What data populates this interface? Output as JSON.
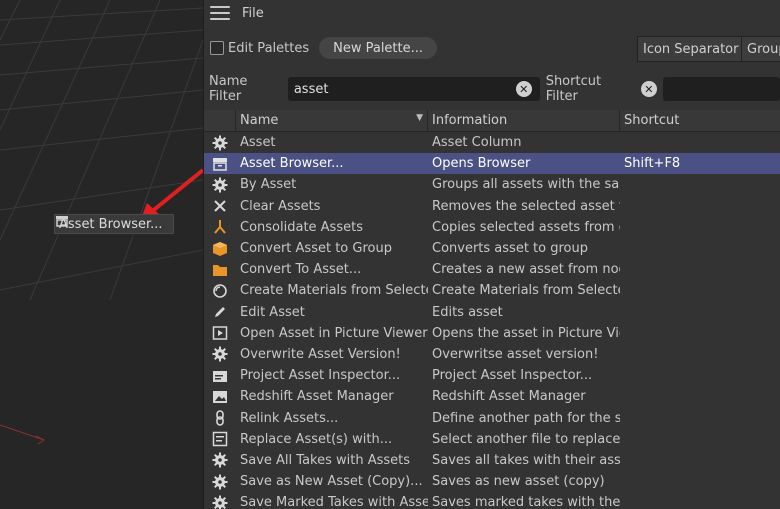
{
  "viewport": {
    "dragged_label": "Asset Browser...",
    "dragged_icon": "asset-browser-icon"
  },
  "menubar": {
    "menu_icon": "hamburger-icon",
    "file_label": "File"
  },
  "toolbar": {
    "edit_palettes_label": "Edit Palettes",
    "new_palette_label": "New Palette...",
    "icon_separator_label": "Icon Separator",
    "group_label": "Group"
  },
  "filters": {
    "name_filter_label": "Name Filter",
    "name_filter_value": "asset",
    "shortcut_filter_label": "Shortcut Filter",
    "shortcut_filter_value": ""
  },
  "table": {
    "columns": [
      "Name",
      "Information",
      "Shortcut"
    ],
    "rows": [
      {
        "icon": "gear-icon",
        "name": "Asset",
        "info": "Asset Column",
        "shortcut": ""
      },
      {
        "icon": "asset-browser-icon",
        "name": "Asset Browser...",
        "info": "Opens Browser",
        "shortcut": "Shift+F8",
        "selected": true
      },
      {
        "icon": "gear-icon",
        "name": "By Asset",
        "info": "Groups all assets with the same",
        "shortcut": ""
      },
      {
        "icon": "close-icon",
        "name": "Clear Assets",
        "info": "Removes the selected asset fro",
        "shortcut": ""
      },
      {
        "icon": "merge-icon",
        "name": "Consolidate Assets",
        "info": "Copies selected assets from dif",
        "shortcut": ""
      },
      {
        "icon": "box-icon",
        "name": "Convert Asset to Group",
        "info": "Converts asset to group",
        "shortcut": ""
      },
      {
        "icon": "folder-icon",
        "name": "Convert To Asset...",
        "info": "Creates a new asset from node",
        "shortcut": ""
      },
      {
        "icon": "material-icon",
        "name": "Create Materials from Selected",
        "info": "Create Materials from Selected",
        "shortcut": ""
      },
      {
        "icon": "pencil-icon",
        "name": "Edit Asset",
        "info": "Edits asset",
        "shortcut": ""
      },
      {
        "icon": "picture-viewer-icon",
        "name": "Open Asset in Picture Viewer",
        "info": "Opens the asset in Picture View",
        "shortcut": ""
      },
      {
        "icon": "gear-icon",
        "name": "Overwrite Asset Version!",
        "info": "Overwritse asset version!",
        "shortcut": ""
      },
      {
        "icon": "inspector-icon",
        "name": "Project Asset Inspector...",
        "info": "Project Asset Inspector...",
        "shortcut": ""
      },
      {
        "icon": "image-icon",
        "name": "Redshift Asset Manager",
        "info": "Redshift Asset Manager",
        "shortcut": ""
      },
      {
        "icon": "link-icon",
        "name": "Relink Assets...",
        "info": "Define another path for the sel",
        "shortcut": ""
      },
      {
        "icon": "replace-icon",
        "name": "Replace Asset(s) with...",
        "info": "Select another file to replace th",
        "shortcut": ""
      },
      {
        "icon": "gear-icon",
        "name": "Save All Takes with Assets",
        "info": "Saves all takes with their assets",
        "shortcut": ""
      },
      {
        "icon": "gear-icon",
        "name": "Save as New Asset (Copy)...",
        "info": "Saves as new asset (copy)",
        "shortcut": ""
      },
      {
        "icon": "gear-icon",
        "name": "Save Marked Takes with Assets",
        "info": "Saves marked takes with their a",
        "shortcut": ""
      }
    ]
  },
  "colors": {
    "selection": "#4b5085",
    "arrow": "#e02020",
    "panel": "#333333",
    "viewport": "#262626"
  }
}
